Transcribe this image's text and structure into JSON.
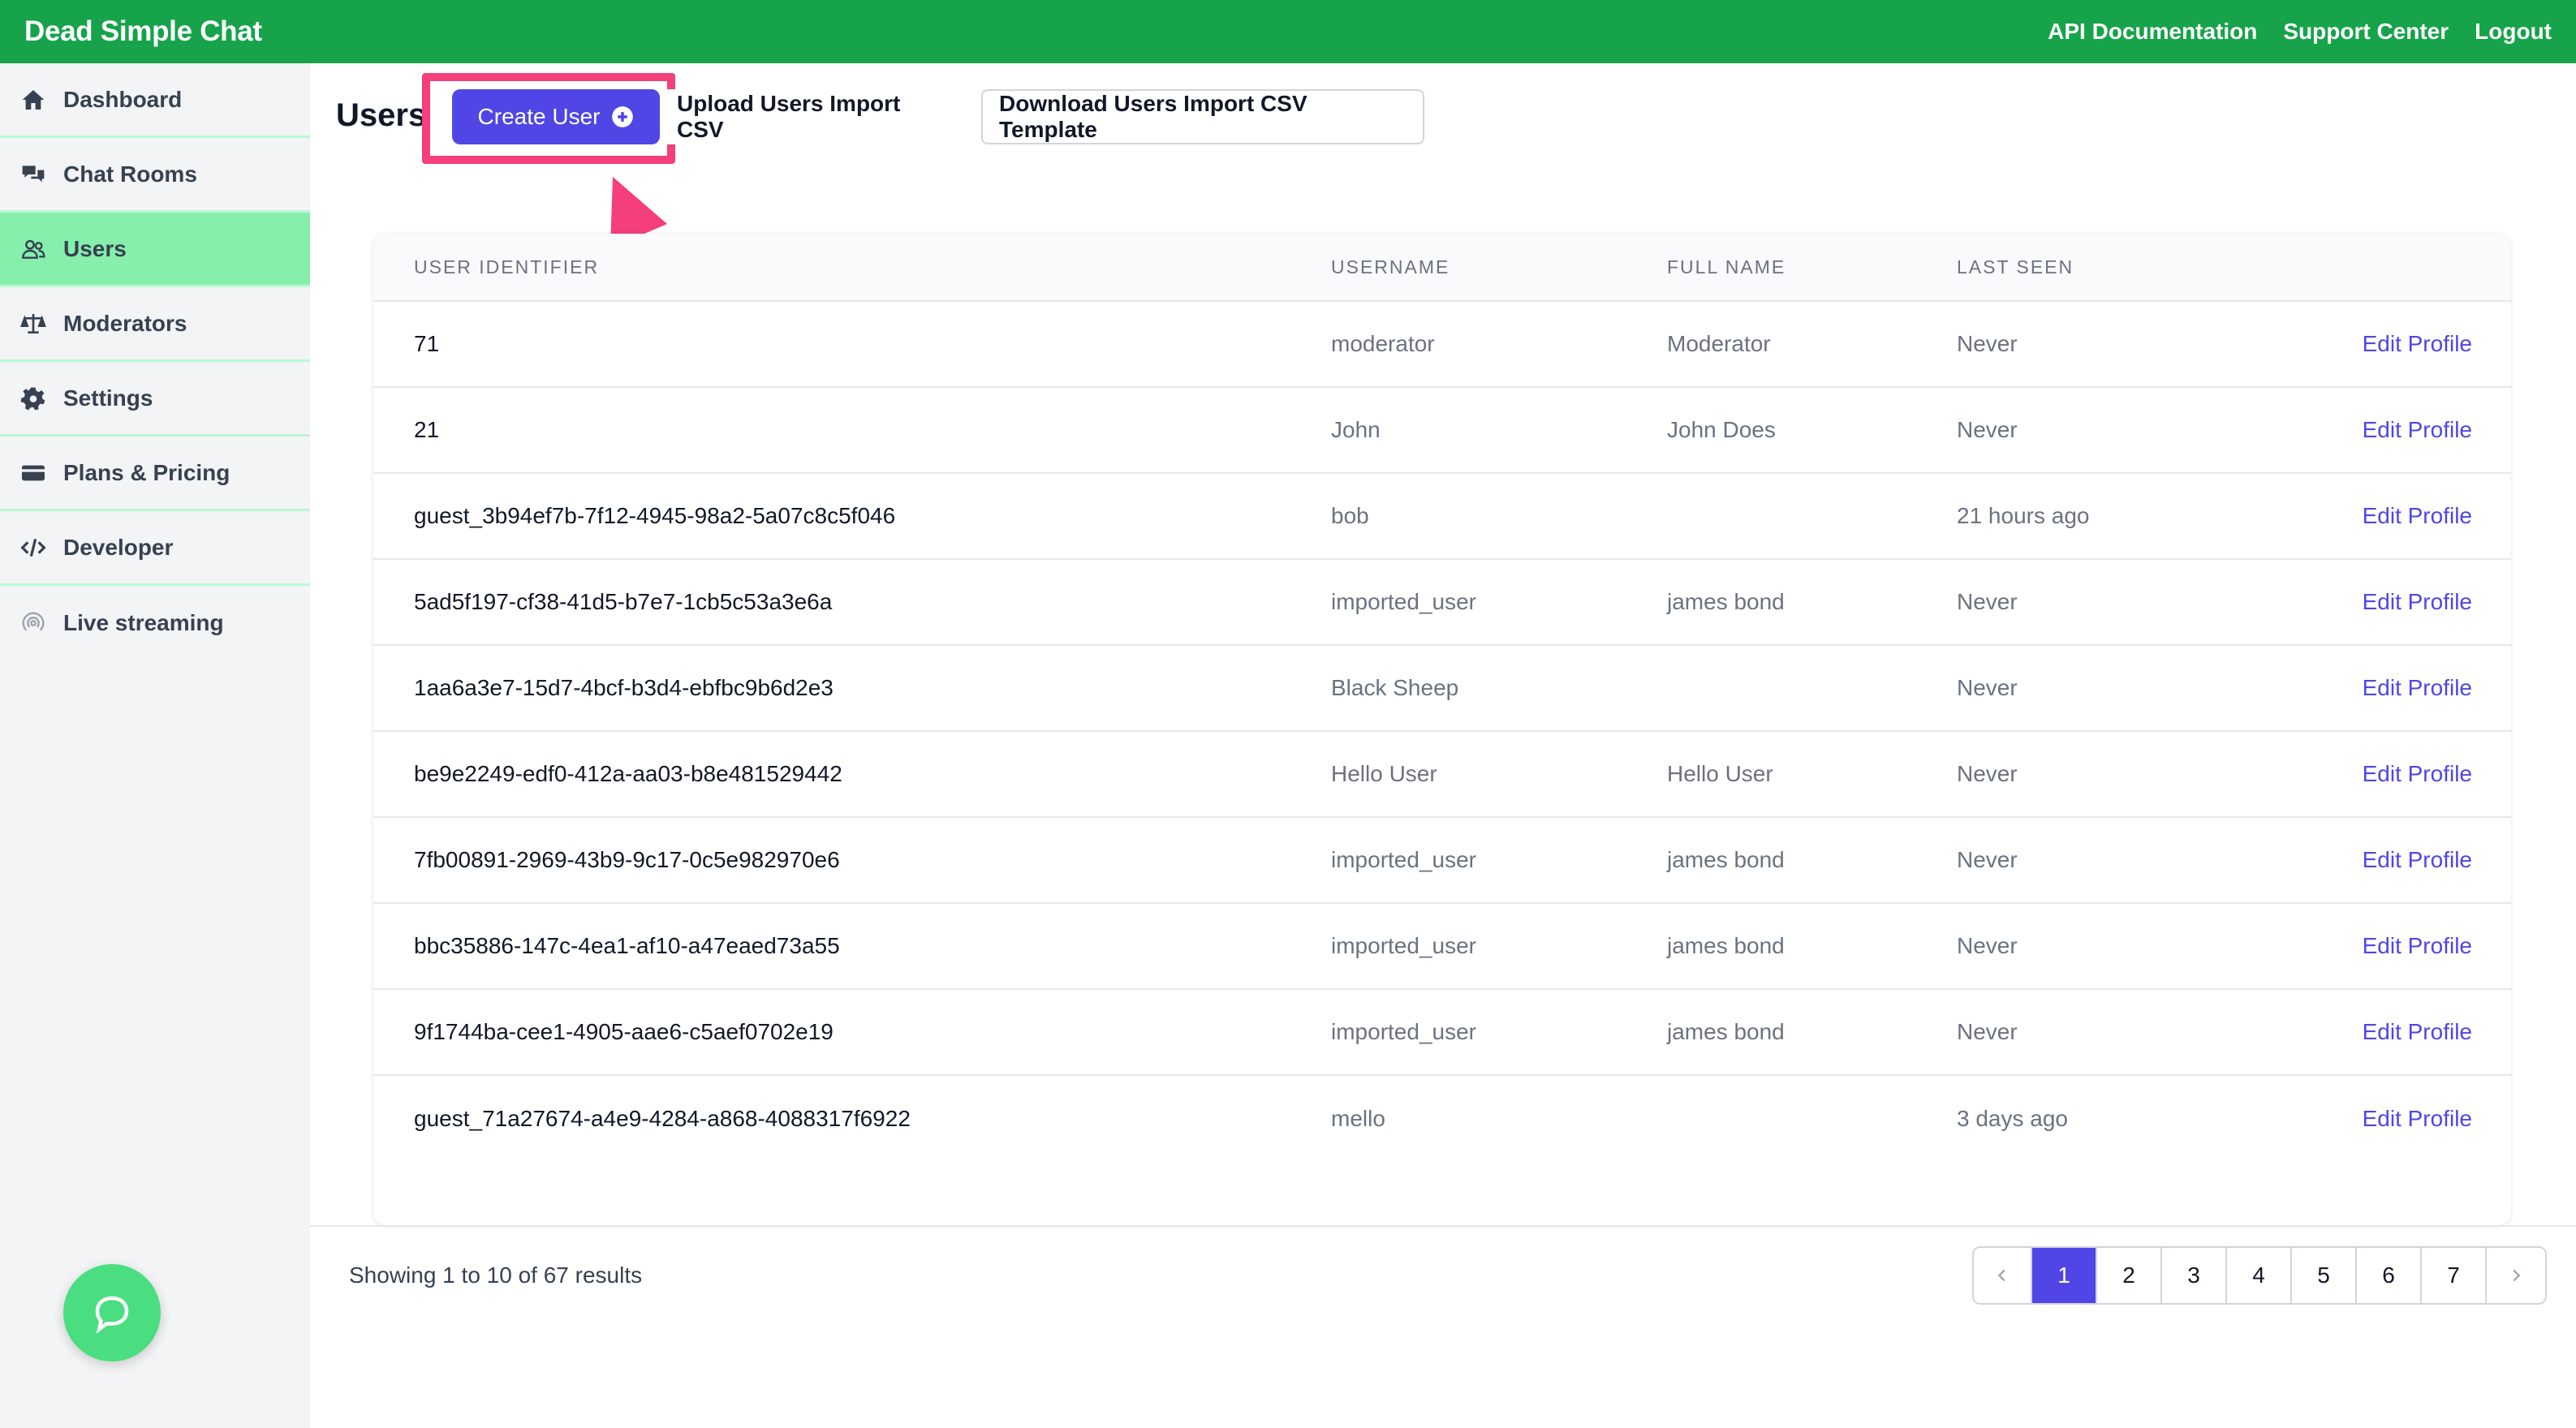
{
  "app": {
    "brand": "Dead Simple Chat",
    "top_links": [
      "API Documentation",
      "Support Center",
      "Logout"
    ]
  },
  "sidebar": {
    "items": [
      {
        "label": "Dashboard",
        "icon": "home-icon"
      },
      {
        "label": "Chat Rooms",
        "icon": "chat-bubbles-icon"
      },
      {
        "label": "Users",
        "icon": "users-icon",
        "active": true
      },
      {
        "label": "Moderators",
        "icon": "scale-icon"
      },
      {
        "label": "Settings",
        "icon": "gear-icon"
      },
      {
        "label": "Plans & Pricing",
        "icon": "credit-card-icon"
      },
      {
        "label": "Developer",
        "icon": "code-icon"
      },
      {
        "label": "Live streaming",
        "icon": "broadcast-icon"
      }
    ]
  },
  "page": {
    "title": "Users",
    "create_button": "Create User",
    "upload_button": "Upload Users Import CSV",
    "download_button": "Download Users Import CSV Template"
  },
  "table": {
    "headers": [
      "USER IDENTIFIER",
      "USERNAME",
      "FULL NAME",
      "LAST SEEN"
    ],
    "action_label": "Edit Profile",
    "rows": [
      {
        "id": "71",
        "username": "moderator",
        "full_name": "Moderator",
        "last_seen": "Never"
      },
      {
        "id": "21",
        "username": "John",
        "full_name": "John Does",
        "last_seen": "Never"
      },
      {
        "id": "guest_3b94ef7b-7f12-4945-98a2-5a07c8c5f046",
        "username": "bob",
        "full_name": "",
        "last_seen": "21 hours ago"
      },
      {
        "id": "5ad5f197-cf38-41d5-b7e7-1cb5c53a3e6a",
        "username": "imported_user",
        "full_name": "james bond",
        "last_seen": "Never"
      },
      {
        "id": "1aa6a3e7-15d7-4bcf-b3d4-ebfbc9b6d2e3",
        "username": "Black Sheep",
        "full_name": "",
        "last_seen": "Never"
      },
      {
        "id": "be9e2249-edf0-412a-aa03-b8e481529442",
        "username": "Hello User",
        "full_name": "Hello User",
        "last_seen": "Never"
      },
      {
        "id": "7fb00891-2969-43b9-9c17-0c5e982970e6",
        "username": "imported_user",
        "full_name": "james bond",
        "last_seen": "Never"
      },
      {
        "id": "bbc35886-147c-4ea1-af10-a47eaed73a55",
        "username": "imported_user",
        "full_name": "james bond",
        "last_seen": "Never"
      },
      {
        "id": "9f1744ba-cee1-4905-aae6-c5aef0702e19",
        "username": "imported_user",
        "full_name": "james bond",
        "last_seen": "Never"
      },
      {
        "id": "guest_71a27674-a4e9-4284-a868-4088317f6922",
        "username": "mello",
        "full_name": "",
        "last_seen": "3 days ago"
      }
    ]
  },
  "footer": {
    "showing_text": "Showing 1 to 10 of 67 results",
    "pages": [
      "1",
      "2",
      "3",
      "4",
      "5",
      "6",
      "7"
    ],
    "current_page": "1"
  },
  "colors": {
    "topbar": "#16a34a",
    "accent": "#4f46e5",
    "active_nav": "#86efac",
    "highlight": "#f43f7a"
  }
}
